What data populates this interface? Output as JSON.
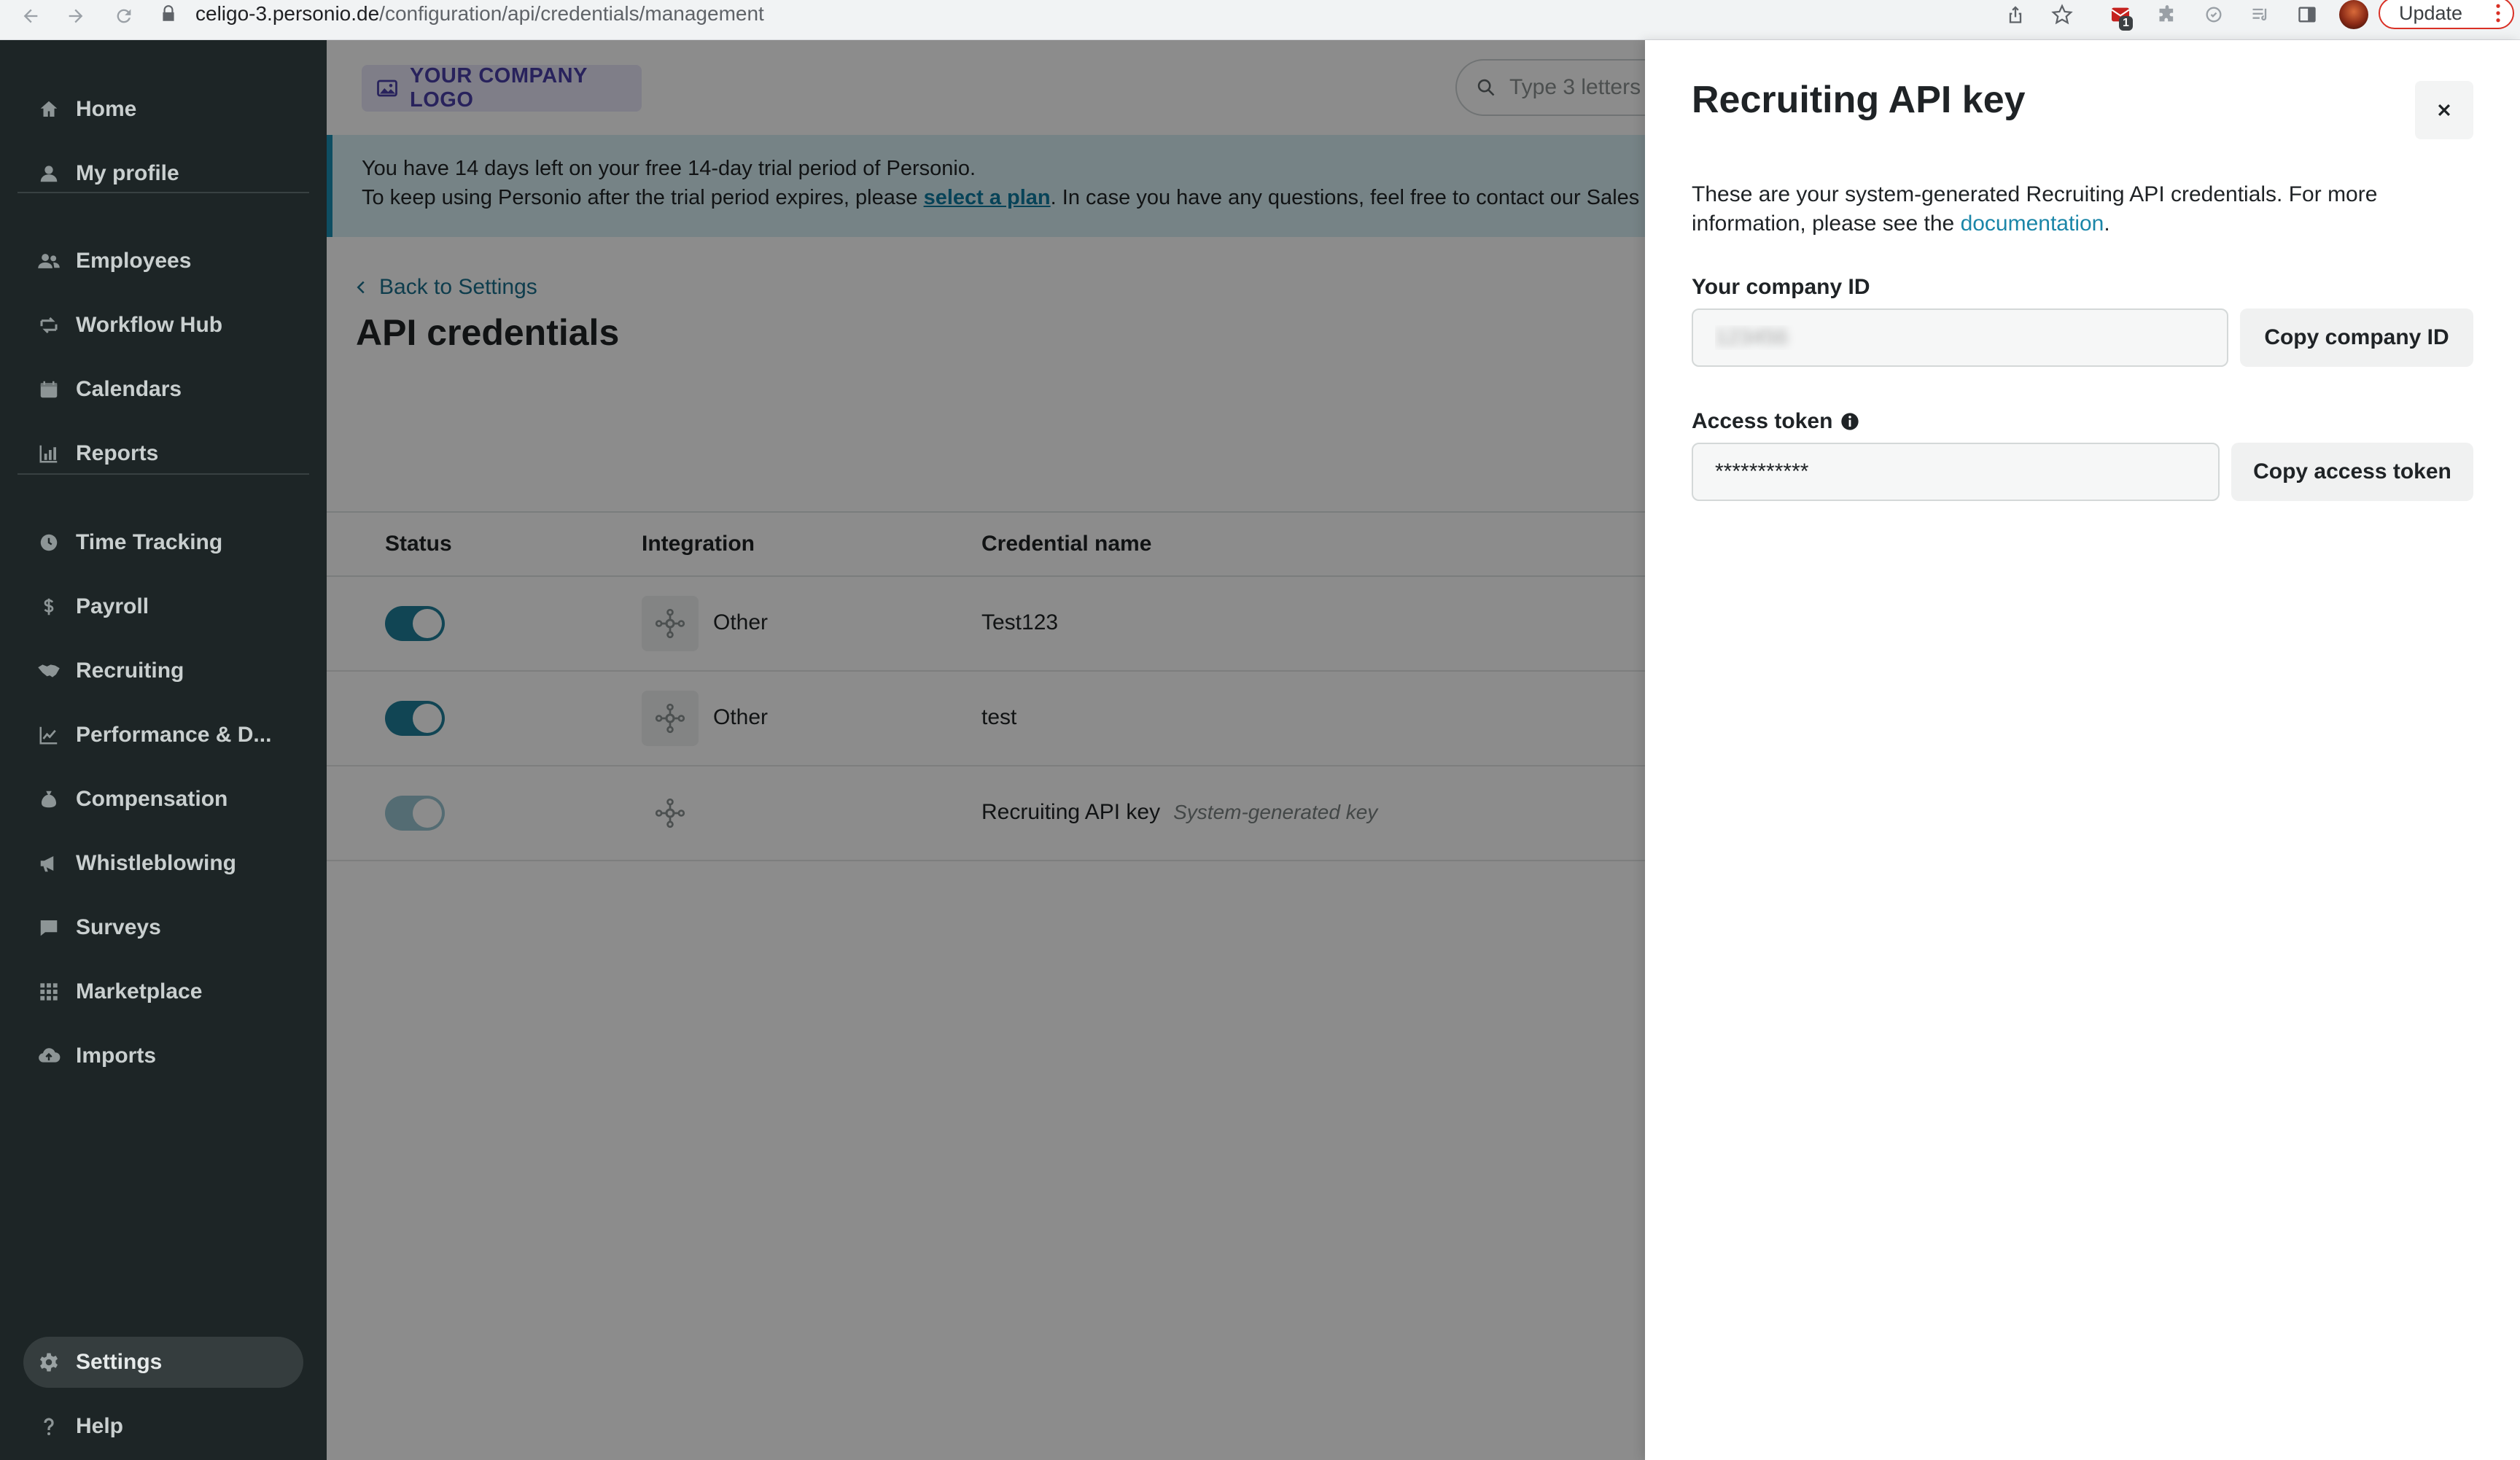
{
  "browser": {
    "url_host": "celigo-3.personio.de",
    "url_path": "/configuration/api/credentials/management",
    "update_label": "Update",
    "extension_badge": "1"
  },
  "sidebar": {
    "items": [
      {
        "label": "Home",
        "icon": "home-icon"
      },
      {
        "label": "My profile",
        "icon": "user-icon"
      },
      {
        "label": "Employees",
        "icon": "people-icon"
      },
      {
        "label": "Workflow Hub",
        "icon": "workflow-icon"
      },
      {
        "label": "Calendars",
        "icon": "calendar-icon"
      },
      {
        "label": "Reports",
        "icon": "bar-chart-icon"
      },
      {
        "label": "Time Tracking",
        "icon": "clock-icon"
      },
      {
        "label": "Payroll",
        "icon": "dollar-icon"
      },
      {
        "label": "Recruiting",
        "icon": "handshake-icon"
      },
      {
        "label": "Performance & D...",
        "icon": "trend-icon"
      },
      {
        "label": "Compensation",
        "icon": "moneybag-icon"
      },
      {
        "label": "Whistleblowing",
        "icon": "megaphone-icon"
      },
      {
        "label": "Surveys",
        "icon": "chat-icon"
      },
      {
        "label": "Marketplace",
        "icon": "grid-icon"
      },
      {
        "label": "Imports",
        "icon": "cloud-upload-icon"
      },
      {
        "label": "Settings",
        "icon": "gear-icon",
        "active": true
      },
      {
        "label": "Help",
        "icon": "question-icon"
      }
    ]
  },
  "header": {
    "logo_text": "YOUR COMPANY LOGO",
    "search_placeholder": "Type 3 letters"
  },
  "banner": {
    "line1": "You have 14 days left on your free 14-day trial period of Personio.",
    "line2_pre": "To keep using Personio after the trial period expires, please ",
    "line2_link": "select a plan",
    "line2_post": ". In case you have any questions, feel free to contact our Sales"
  },
  "page": {
    "back_label": "Back to Settings",
    "title": "API credentials"
  },
  "table": {
    "headers": {
      "status": "Status",
      "integration": "Integration",
      "credential": "Credential name"
    },
    "rows": [
      {
        "enabled": true,
        "integration": "Other",
        "name": "Test123",
        "note": ""
      },
      {
        "enabled": true,
        "integration": "Other",
        "name": "test",
        "note": ""
      },
      {
        "enabled": true,
        "disabled_control": true,
        "integration": "",
        "name": "Recruiting API key",
        "note": "System-generated key"
      }
    ]
  },
  "drawer": {
    "title": "Recruiting API key",
    "desc_pre": "These are your system-generated Recruiting API credentials. For more information, please see the ",
    "desc_link": "documentation",
    "desc_post": ".",
    "company_id_label": "Your company ID",
    "company_id_value": "123456",
    "copy_company_id": "Copy company ID",
    "access_token_label": "Access token",
    "access_token_value": "***********",
    "copy_access_token": "Copy access token"
  },
  "colors": {
    "sidebar_bg": "#1d2526",
    "accent": "#1f7f9a",
    "banner_bg": "#d7eef5",
    "link": "#1b86a8"
  }
}
